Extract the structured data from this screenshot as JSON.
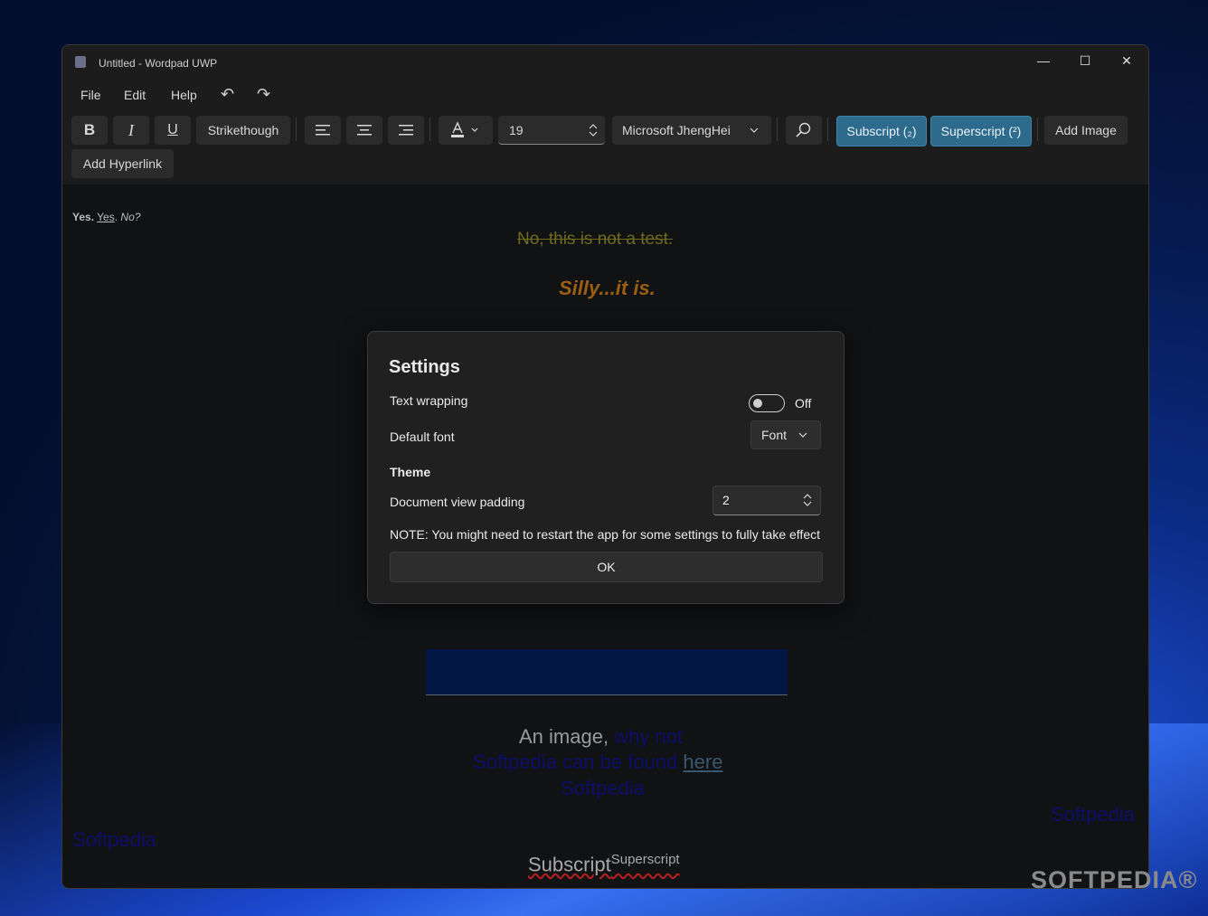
{
  "window": {
    "title": "Untitled - Wordpad UWP",
    "controls": {
      "minimize": "—",
      "maximize": "☐",
      "close": "✕"
    }
  },
  "menu": {
    "file": "File",
    "edit": "Edit",
    "help": "Help",
    "undo_glyph": "↶",
    "redo_glyph": "↷"
  },
  "toolbar": {
    "bold": "B",
    "italic": "I",
    "underline": "U",
    "strikethrough": "Strikethough",
    "font_size": "19",
    "font_name": "Microsoft JhengHei",
    "subscript": "Subscript (₂)",
    "superscript": "Superscript (²)",
    "add_image": "Add Image",
    "add_hyperlink": "Add Hyperlink"
  },
  "document": {
    "line1_bold": "Yes.",
    "line1_underline": "Yes",
    "line1_dot": ".",
    "line1_italic": "No?",
    "strike_line": "No, this is not a test.",
    "silly_line": "Silly...it is.",
    "image_caption_start": "An image,",
    "image_caption_link": " why not",
    "found_text": "Softpedia can be found ",
    "here_link": "here",
    "softpedia_center": "Softpedia",
    "softpedia_right": "Softpedia",
    "softpedia_left": "Softpedia",
    "subscript_word": "Subscript",
    "superscript_word": "Superscript"
  },
  "dialog": {
    "title": "Settings",
    "text_wrapping_label": "Text wrapping",
    "text_wrapping_state": "Off",
    "default_font_label": "Default font",
    "default_font_value": "Font",
    "theme_label": "Theme",
    "padding_label": "Document view padding",
    "padding_value": "2",
    "note": "NOTE: You might need to restart the app for some settings to fully take effect",
    "ok_label": "OK"
  },
  "watermark": "SOFTPEDIA®"
}
